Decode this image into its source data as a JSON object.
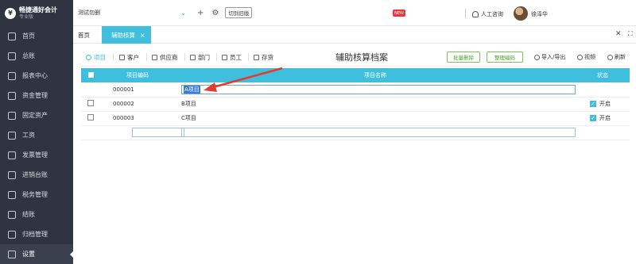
{
  "app": {
    "logo_title": "畅捷通好会计",
    "logo_sub": "专业版",
    "company": "测试勿删",
    "switch_label": "切到旧版",
    "new_badge": "NEW",
    "support_label": "人工咨询",
    "username": "徐泽华"
  },
  "sidebar": {
    "items": [
      {
        "label": "首页"
      },
      {
        "label": "总账"
      },
      {
        "label": "报表中心"
      },
      {
        "label": "资金管理"
      },
      {
        "label": "固定资产"
      },
      {
        "label": "工资"
      },
      {
        "label": "发票管理"
      },
      {
        "label": "进销台账"
      },
      {
        "label": "税务管理"
      },
      {
        "label": "结账"
      },
      {
        "label": "归档管理"
      },
      {
        "label": "设置"
      }
    ]
  },
  "tabs": {
    "home": "首页",
    "active": "辅助核算",
    "close": "×"
  },
  "categories": [
    "项目",
    "客户",
    "供应商",
    "部门",
    "员工",
    "存货"
  ],
  "page_title": "辅助核算档案",
  "actions": {
    "batch_delete": "批量删除",
    "reorg_code": "整理编码",
    "import_export": "导入/导出",
    "video": "视频",
    "refresh": "刷新"
  },
  "table": {
    "headers": {
      "code": "项目编码",
      "name": "项目名称",
      "status": "状态"
    },
    "rows": [
      {
        "code": "000001",
        "name": "A项目",
        "status": ""
      },
      {
        "code": "000002",
        "name": "B项目",
        "status": "开启"
      },
      {
        "code": "000003",
        "name": "C项目",
        "status": "开启"
      }
    ]
  },
  "colors": {
    "accent": "#3fbfdd",
    "sidebar": "#2f3440",
    "arrow": "#e23c2f",
    "green": "#4aa52b"
  }
}
